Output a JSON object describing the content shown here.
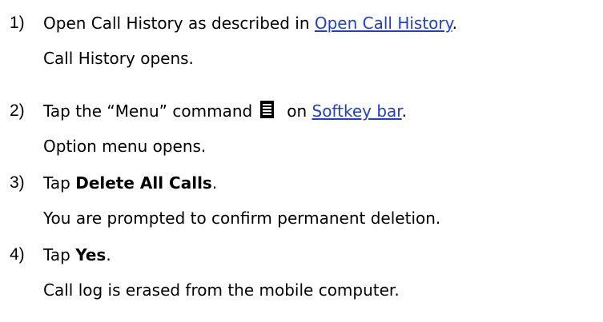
{
  "steps": [
    {
      "number": "1)",
      "text_before": "Open Call History as described in ",
      "link": "Open Call History",
      "text_after": ".",
      "result": "Call History opens."
    },
    {
      "number": "2)",
      "text_before": "Tap the “Menu” command",
      "icon": "menu-command-icon",
      "text_middle": "on ",
      "link": "Softkey bar",
      "text_after": ".",
      "result": "Option menu opens."
    },
    {
      "number": "3)",
      "text_before": "Tap ",
      "bold": "Delete All Calls",
      "text_after": ".",
      "result": "You are prompted to confirm permanent deletion."
    },
    {
      "number": "4)",
      "text_before": "Tap ",
      "bold": "Yes",
      "text_after": ".",
      "result": "Call log is erased from the mobile computer."
    }
  ],
  "colors": {
    "link": "#1f3dd8",
    "text": "#000000"
  }
}
